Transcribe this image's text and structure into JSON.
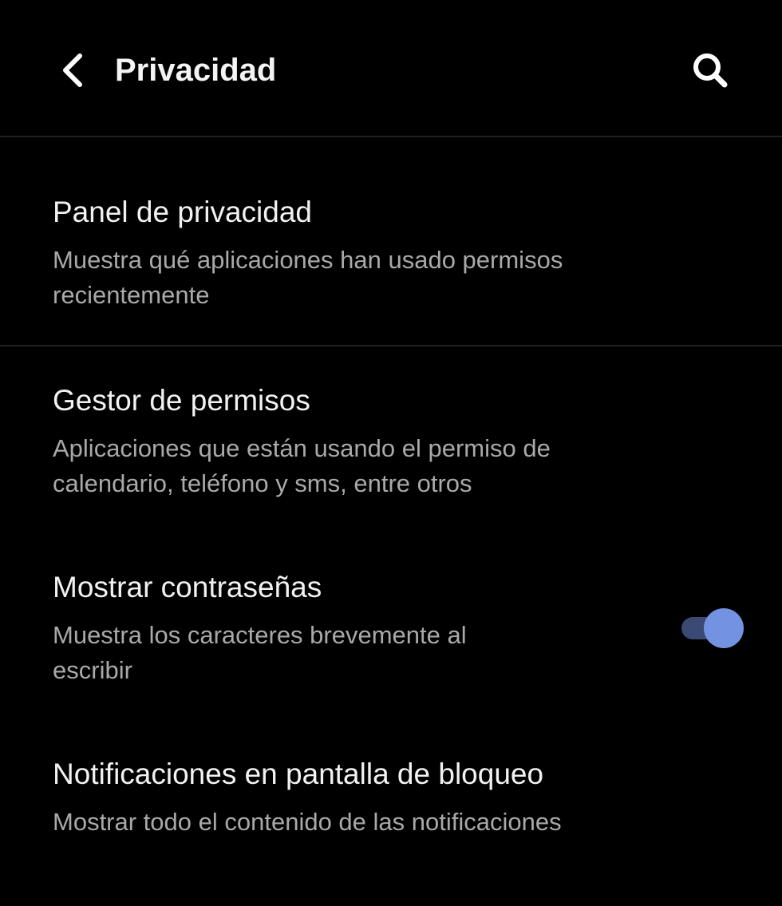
{
  "header": {
    "title": "Privacidad"
  },
  "settings": [
    {
      "title": "Panel de privacidad",
      "summary_line1": "Muestra qué aplicaciones han usado permisos",
      "summary_line2": "recientemente"
    },
    {
      "title": "Gestor de permisos",
      "summary_line1": "Aplicaciones que están usando el permiso de",
      "summary_line2": "calendario, teléfono y sms, entre otros"
    },
    {
      "title": "Mostrar contraseñas",
      "summary_line1": "Muestra los caracteres brevemente al",
      "summary_line2": "escribir",
      "toggle_on": true
    },
    {
      "title": "Notificaciones en pantalla de bloqueo",
      "summary_line1": "Mostrar todo el contenido de las notificaciones"
    }
  ],
  "colors": {
    "background": "#000000",
    "title_text": "#f2f2f2",
    "summary_text": "#a9a9a9",
    "toggle_thumb": "#7393e2",
    "toggle_track": "#3b4a74"
  },
  "icons": {
    "back": "chevron-left-icon",
    "search": "search-icon"
  }
}
